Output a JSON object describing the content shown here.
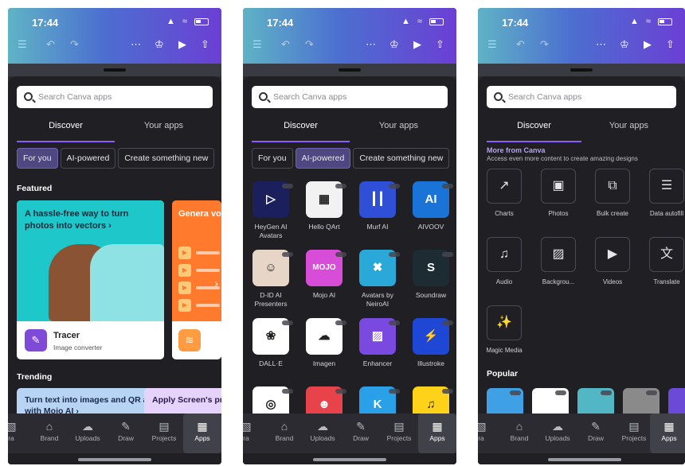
{
  "status": {
    "time": "17:44"
  },
  "search": {
    "placeholder": "Search Canva apps"
  },
  "tabs": {
    "discover": "Discover",
    "your_apps": "Your apps"
  },
  "chips": {
    "for_you": "For you",
    "ai_powered": "AI-powered",
    "create": "Create something new"
  },
  "screen1": {
    "featured_title": "Featured",
    "feature_main": {
      "headline": "A hassle-free way to turn photos into vectors ›",
      "app_name": "Tracer",
      "app_sub": "Image converter"
    },
    "feature_second": {
      "headline": "Genera voiceo"
    },
    "trending_title": "Trending",
    "trend_cards": [
      "Turn text into images and QR art with Mojo AI ›",
      "Apply Screen's print filters to"
    ]
  },
  "screen2": {
    "apps": [
      {
        "label": "HeyGen AI Avatars",
        "glyph": "▷",
        "color": "#1b1f5c"
      },
      {
        "label": "Hello QArt",
        "glyph": "▦",
        "color": "#f2f2f2"
      },
      {
        "label": "Murf AI",
        "glyph": "┃┃",
        "color": "#2e4fd6"
      },
      {
        "label": "AIVOOV",
        "glyph": "AI",
        "color": "#1a74d8"
      },
      {
        "label": "D-ID AI Presenters",
        "glyph": "☺",
        "color": "#e7d6c8"
      },
      {
        "label": "Mojo AI",
        "glyph": "MOJO",
        "color": "#d84dd8"
      },
      {
        "label": "Avatars by NeiroAI",
        "glyph": "✖",
        "color": "#2aa8d8"
      },
      {
        "label": "Soundraw",
        "glyph": "S",
        "color": "#1d2c33"
      },
      {
        "label": "DALL·E",
        "glyph": "❀",
        "color": "#ffffff"
      },
      {
        "label": "Imagen",
        "glyph": "☁",
        "color": "#ffffff"
      },
      {
        "label": "Enhancer",
        "glyph": "▨",
        "color": "#7a4ae0"
      },
      {
        "label": "Illustroke",
        "glyph": "⚡",
        "color": "#1f47d6"
      },
      {
        "label": "",
        "glyph": "◎",
        "color": "#ffffff"
      },
      {
        "label": "",
        "glyph": "☻",
        "color": "#e8434a"
      },
      {
        "label": "",
        "glyph": "K",
        "color": "#2aa0e8"
      },
      {
        "label": "",
        "glyph": "♫",
        "color": "#ffd21a"
      }
    ]
  },
  "screen3": {
    "more_title": "More from Canva",
    "more_desc": "Access even more content to create amazing designs",
    "tools": [
      {
        "label": "Charts",
        "glyph": "↗"
      },
      {
        "label": "Photos",
        "glyph": "▣"
      },
      {
        "label": "Bulk create",
        "glyph": "⧉"
      },
      {
        "label": "Data autofill",
        "glyph": "☰"
      },
      {
        "label": "Audio",
        "glyph": "♫"
      },
      {
        "label": "Backgrou...",
        "glyph": "▨"
      },
      {
        "label": "Videos",
        "glyph": "▶"
      },
      {
        "label": "Translate",
        "glyph": "文"
      },
      {
        "label": "Magic Media",
        "glyph": "✨"
      }
    ],
    "popular_title": "Popular",
    "popular_colors": [
      "#3fa0e6",
      "#ffffff",
      "#52b7c4",
      "#8a8a8a",
      "#6b4ad8"
    ]
  },
  "nav": [
    {
      "label": "ra",
      "glyph": "▧"
    },
    {
      "label": "Brand",
      "glyph": "⌂"
    },
    {
      "label": "Uploads",
      "glyph": "☁"
    },
    {
      "label": "Draw",
      "glyph": "✎"
    },
    {
      "label": "Projects",
      "glyph": "▤"
    },
    {
      "label": "Apps",
      "glyph": "▦"
    }
  ],
  "accent": "#8b5cf6"
}
